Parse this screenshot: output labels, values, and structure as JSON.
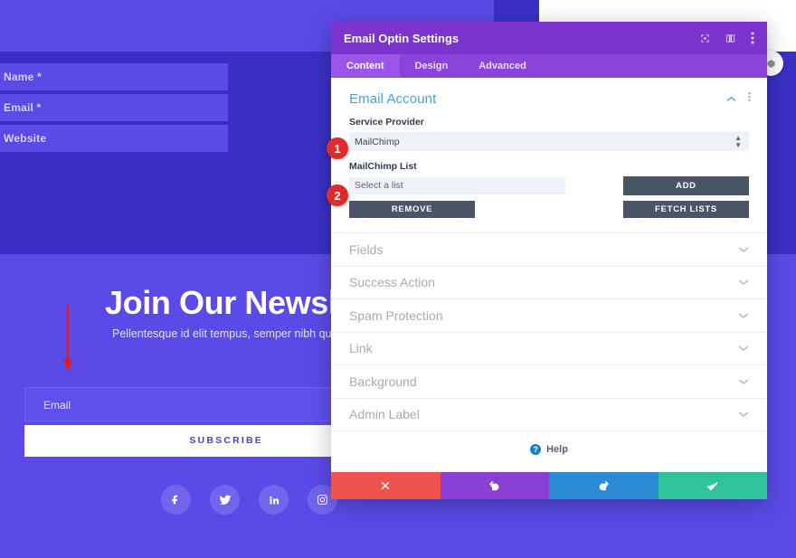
{
  "background": {
    "optin_form": {
      "fields": [
        {
          "placeholder": "Name *"
        },
        {
          "placeholder": "Email *"
        },
        {
          "placeholder": "Website"
        }
      ]
    },
    "newsletter": {
      "title": "Join Our Newslett",
      "subtitle": "Pellentesque id elit tempus, semper nibh quis, dictu",
      "email_placeholder": "Email",
      "subscribe_label": "SUBSCRIBE"
    },
    "social": [
      {
        "name": "facebook-icon",
        "label": "Facebook"
      },
      {
        "name": "twitter-icon",
        "label": "Twitter"
      },
      {
        "name": "linkedin-icon",
        "label": "LinkedIn"
      },
      {
        "name": "instagram-icon",
        "label": "Instagram"
      }
    ],
    "colors": {
      "band_light": "#5b4ae8",
      "band_dark": "#3a2fc4",
      "field": "#5f50ee",
      "subscribe_text": "#4a3fd0"
    }
  },
  "annotations": {
    "badges": [
      {
        "number": "1",
        "target": "service-provider-select"
      },
      {
        "number": "2",
        "target": "mailchimp-list-input"
      }
    ],
    "arrow": {
      "name": "red-down-arrow",
      "color": "#e01b1b",
      "direction": "down"
    }
  },
  "modal": {
    "title": "Email Optin Settings",
    "header_icons": [
      {
        "name": "fullscreen-icon"
      },
      {
        "name": "layout-toggle-icon"
      },
      {
        "name": "more-vertical-icon"
      }
    ],
    "tabs": [
      {
        "label": "Content",
        "active": true
      },
      {
        "label": "Design",
        "active": false
      },
      {
        "label": "Advanced",
        "active": false
      }
    ],
    "section": {
      "title": "Email Account",
      "collapse_icon": "chevron-up-icon",
      "menu_icon": "more-vertical-icon",
      "service_provider": {
        "label": "Service Provider",
        "value": "MailChimp"
      },
      "mailchimp_list": {
        "label": "MailChimp List",
        "value": "Select a list"
      },
      "buttons": {
        "add": "ADD",
        "remove": "REMOVE",
        "fetch": "FETCH LISTS"
      }
    },
    "accordions": [
      {
        "label": "Fields"
      },
      {
        "label": "Success Action"
      },
      {
        "label": "Spam Protection"
      },
      {
        "label": "Link"
      },
      {
        "label": "Background"
      },
      {
        "label": "Admin Label"
      }
    ],
    "help": {
      "label": "Help",
      "icon": "question-circle-icon"
    },
    "actions": [
      {
        "name": "cancel-button",
        "icon": "close-icon",
        "color": "#ef5350"
      },
      {
        "name": "undo-button",
        "icon": "undo-icon",
        "color": "#8b3fd4"
      },
      {
        "name": "redo-button",
        "icon": "redo-icon",
        "color": "#2a8bd4"
      },
      {
        "name": "save-button",
        "icon": "check-icon",
        "color": "#2fc39a"
      }
    ],
    "colors": {
      "header": "#7b34ce",
      "tabbar": "#8b44d9",
      "tab_active": "#9b55e8"
    }
  }
}
